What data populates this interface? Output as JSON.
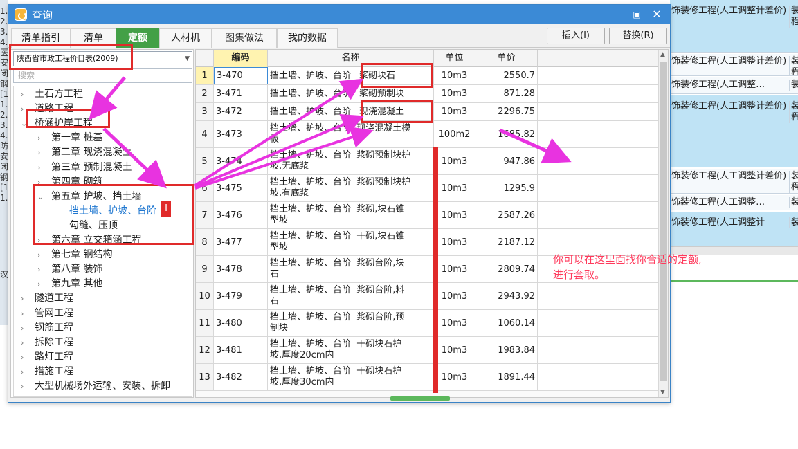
{
  "background": {
    "left_strip_lines": [
      "1.",
      "2.",
      "3.",
      "4.",
      "医",
      "安",
      "闭",
      "钢",
      "[1",
      "1.",
      "2.",
      "3.",
      "4.",
      "防",
      "安",
      "闭",
      "钢",
      "[1",
      "1."
    ],
    "right_rows": [
      {
        "a": "饰装修工程(人工调整计差价)",
        "b": "装程",
        "style": "blue"
      },
      {
        "a": "饰装修工程(人工调整计差价)",
        "b": "装程",
        "style": "white"
      },
      {
        "a": "饰装修工程(人工调整…",
        "b": "装",
        "style": "white"
      },
      {
        "a": "饰装修工程(人工调整计差价)",
        "b": "装程",
        "style": "blue"
      },
      {
        "a": "饰装修工程(人工调整计差价)",
        "b": "装程",
        "style": "white"
      },
      {
        "a": "饰装修工程(人工调整…",
        "b": "装",
        "style": "white"
      },
      {
        "a": "饰装修工程(人工调整计",
        "b": "装",
        "style": "blue"
      }
    ],
    "bottom_left_text": "汉"
  },
  "dialog": {
    "title": "查询",
    "maximize_icon": "▣",
    "close_icon": "✕",
    "tabs": [
      {
        "label": "清单指引",
        "active": false
      },
      {
        "label": "清单",
        "active": false
      },
      {
        "label": "定额",
        "active": true
      },
      {
        "label": "人材机",
        "active": false
      },
      {
        "label": "图集做法",
        "active": false
      },
      {
        "label": "我的数据",
        "active": false
      }
    ],
    "insert_label": "插入(I)",
    "replace_label": "替换(R)"
  },
  "left_panel": {
    "library_selected": "陕西省市政工程价目表(2009)",
    "search_placeholder": "搜索",
    "tree": [
      {
        "label": "土石方工程",
        "level": 0,
        "arrow": "›"
      },
      {
        "label": "道路工程",
        "level": 0,
        "arrow": "›"
      },
      {
        "label": "桥涵护岸工程",
        "level": 0,
        "arrow": "⌄"
      },
      {
        "label": "第一章  桩基",
        "level": 1,
        "arrow": "›"
      },
      {
        "label": "第二章  现浇混凝土",
        "level": 1,
        "arrow": "›"
      },
      {
        "label": "第三章  预制混凝土",
        "level": 1,
        "arrow": "›"
      },
      {
        "label": "第四章  砌筑",
        "level": 1,
        "arrow": "›"
      },
      {
        "label": "第五章  护坡、挡土墙",
        "level": 1,
        "arrow": "⌄"
      },
      {
        "label": "挡土墙、护坡、台阶",
        "level": 2,
        "arrow": "",
        "selected": true
      },
      {
        "label": "勾缝、压顶",
        "level": 2,
        "arrow": ""
      },
      {
        "label": "第六章  立交箱涵工程",
        "level": 1,
        "arrow": "›"
      },
      {
        "label": "第七章  钢结构",
        "level": 1,
        "arrow": "›"
      },
      {
        "label": "第八章  装饰",
        "level": 1,
        "arrow": "›"
      },
      {
        "label": "第九章  其他",
        "level": 1,
        "arrow": "›"
      },
      {
        "label": "隧道工程",
        "level": 0,
        "arrow": "›"
      },
      {
        "label": "管网工程",
        "level": 0,
        "arrow": "›"
      },
      {
        "label": "钢筋工程",
        "level": 0,
        "arrow": "›"
      },
      {
        "label": "拆除工程",
        "level": 0,
        "arrow": "›"
      },
      {
        "label": "路灯工程",
        "level": 0,
        "arrow": "›"
      },
      {
        "label": "措施工程",
        "level": 0,
        "arrow": "›"
      },
      {
        "label": "大型机械场外运输、安装、拆卸",
        "level": 0,
        "arrow": "›"
      }
    ]
  },
  "grid": {
    "headers": {
      "code": "编码",
      "name": "名称",
      "unit": "单位",
      "price": "单价"
    },
    "rows": [
      {
        "idx": "1",
        "code": "3-470",
        "name_a": "挡土墙、护坡、台阶",
        "name_b": "浆砌块石",
        "unit": "10m3",
        "price": "2550.7"
      },
      {
        "idx": "2",
        "code": "3-471",
        "name_a": "挡土墙、护坡、台阶",
        "name_b": "浆砌预制块",
        "unit": "10m3",
        "price": "871.28"
      },
      {
        "idx": "3",
        "code": "3-472",
        "name_a": "挡土墙、护坡、台阶",
        "name_b": "现浇混凝土",
        "unit": "10m3",
        "price": "2296.75"
      },
      {
        "idx": "4",
        "code": "3-473",
        "name_a": "挡土墙、护坡、台阶  现浇混凝土模",
        "name_b": "板",
        "unit": "100m2",
        "price": "1685.82"
      },
      {
        "idx": "5",
        "code": "3-474",
        "name_a": "挡土墙、护坡、台阶  浆砌预制块护",
        "name_b": "坡,无底浆",
        "unit": "10m3",
        "price": "947.86"
      },
      {
        "idx": "6",
        "code": "3-475",
        "name_a": "挡土墙、护坡、台阶  浆砌预制块护",
        "name_b": "坡,有底浆",
        "unit": "10m3",
        "price": "1295.9"
      },
      {
        "idx": "7",
        "code": "3-476",
        "name_a": "挡土墙、护坡、台阶  浆砌,块石锥",
        "name_b": "型坡",
        "unit": "10m3",
        "price": "2587.26"
      },
      {
        "idx": "8",
        "code": "3-477",
        "name_a": "挡土墙、护坡、台阶  干砌,块石锥",
        "name_b": "型坡",
        "unit": "10m3",
        "price": "2187.12"
      },
      {
        "idx": "9",
        "code": "3-478",
        "name_a": "挡土墙、护坡、台阶  浆砌台阶,块",
        "name_b": "石",
        "unit": "10m3",
        "price": "2809.74"
      },
      {
        "idx": "10",
        "code": "3-479",
        "name_a": "挡土墙、护坡、台阶  浆砌台阶,料",
        "name_b": "石",
        "unit": "10m3",
        "price": "2943.92"
      },
      {
        "idx": "11",
        "code": "3-480",
        "name_a": "挡土墙、护坡、台阶  浆砌台阶,预",
        "name_b": "制块",
        "unit": "10m3",
        "price": "1060.14"
      },
      {
        "idx": "12",
        "code": "3-481",
        "name_a": "挡土墙、护坡、台阶  干砌块石护",
        "name_b": "坡,厚度20cm内",
        "unit": "10m3",
        "price": "1983.84"
      },
      {
        "idx": "13",
        "code": "3-482",
        "name_a": "挡土墙、护坡、台阶  干砌块石护",
        "name_b": "坡,厚度30cm内",
        "unit": "10m3",
        "price": "1891.44"
      }
    ],
    "scroll_up_icon": "▲",
    "scroll_down_icon": "▼"
  },
  "annotation": {
    "note_line1": "你可以在这里面找你合适的定额,",
    "note_line2": "进行套取。",
    "tree_marker": "I",
    "color": "#e02a2a",
    "arrow_color": "#e833e0"
  }
}
